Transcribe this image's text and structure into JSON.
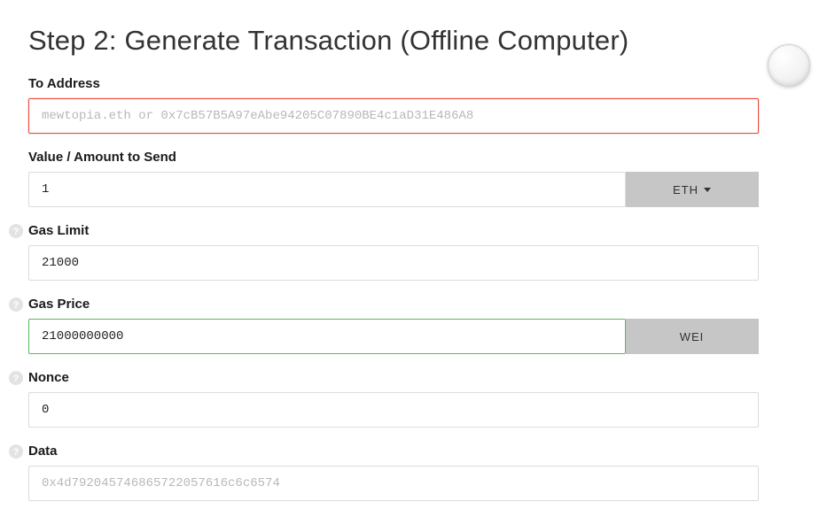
{
  "heading": "Step 2: Generate Transaction (Offline Computer)",
  "toAddress": {
    "label": "To Address",
    "value": "",
    "placeholder": "mewtopia.eth or 0x7cB57B5A97eAbe94205C07890BE4c1aD31E486A8"
  },
  "amount": {
    "label": "Value / Amount to Send",
    "value": "1",
    "unit": "ETH"
  },
  "gasLimit": {
    "label": "Gas Limit",
    "value": "21000"
  },
  "gasPrice": {
    "label": "Gas Price",
    "value": "21000000000",
    "unit": "WEI"
  },
  "nonce": {
    "label": "Nonce",
    "value": "0"
  },
  "data": {
    "label": "Data",
    "value": "",
    "placeholder": "0x4d792045746865722057616c6c6574"
  }
}
